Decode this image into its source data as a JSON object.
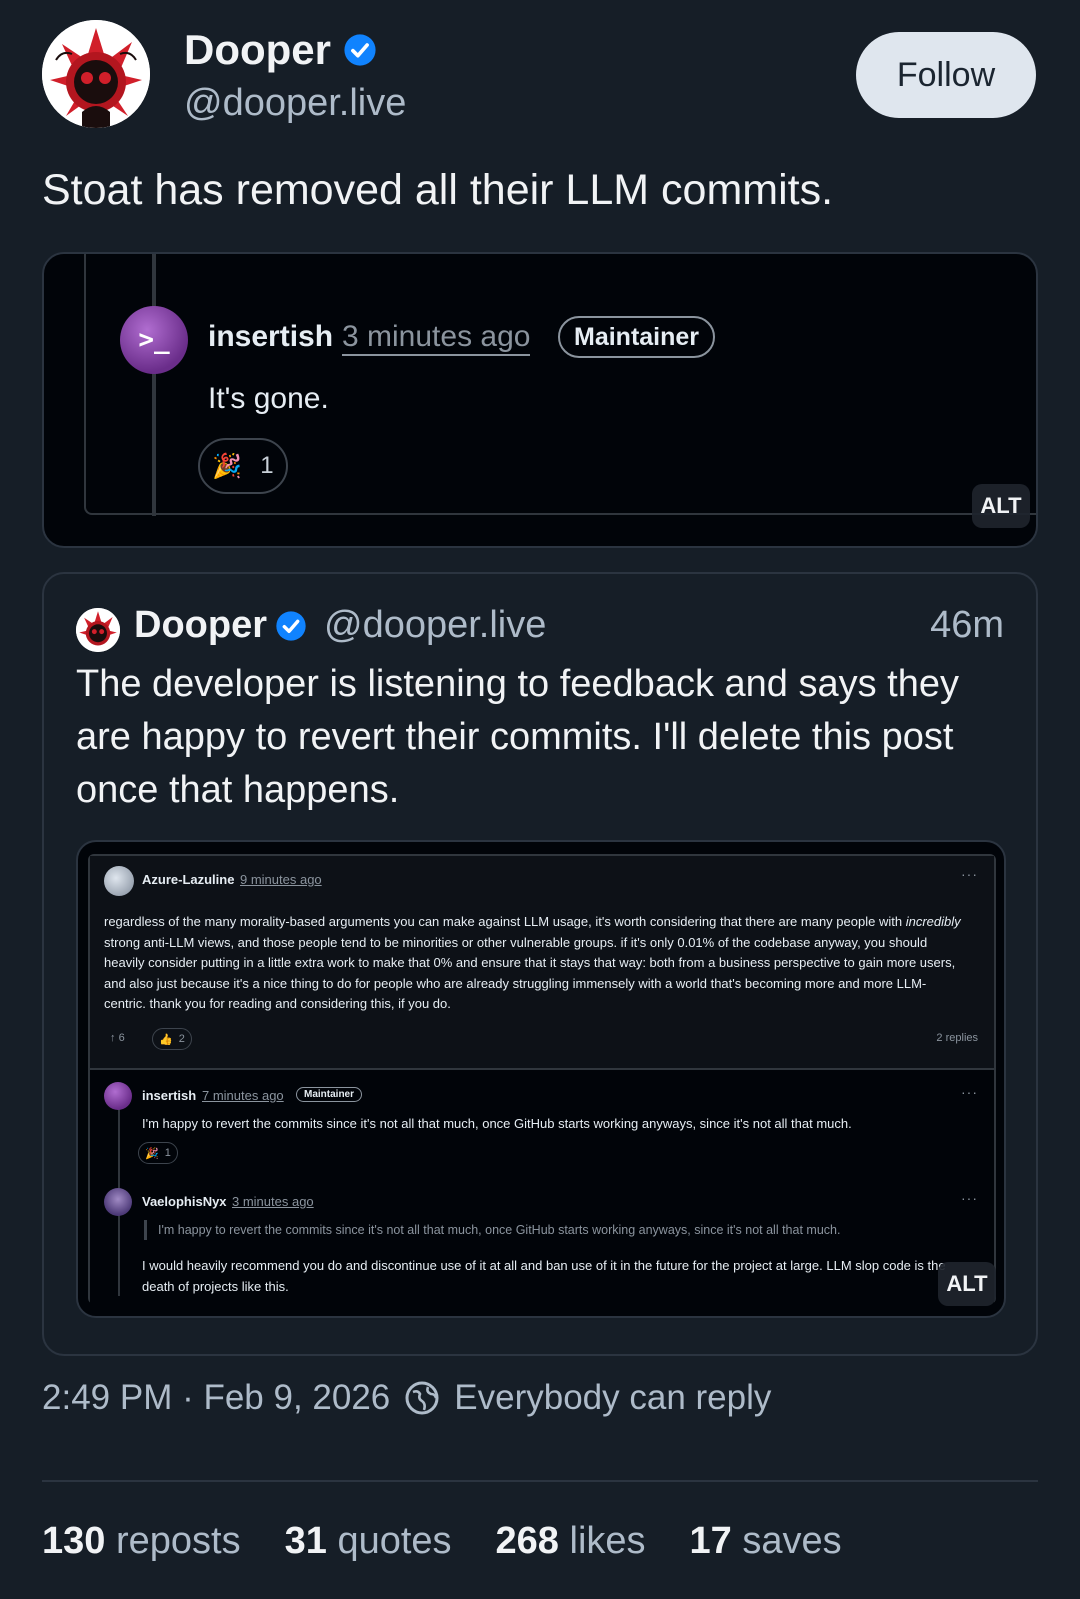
{
  "author": {
    "name": "Dooper",
    "handle": "@dooper.live",
    "avatar_icon": "spiky-red-creature-avatar",
    "verified": true
  },
  "follow_label": "Follow",
  "post_text": "Stoat has removed all their LLM commits.",
  "image1": {
    "user": "insertish",
    "time": "3 minutes ago",
    "badge": "Maintainer",
    "message": "It's gone.",
    "reaction_count": "1",
    "reaction_icon": "party-popper-icon",
    "alt_label": "ALT"
  },
  "quote": {
    "name": "Dooper",
    "handle": "@dooper.live",
    "time": "46m",
    "text": "The developer is listening to feedback and says they are happy to revert their commits. I'll delete this post once that happens.",
    "image": {
      "alt_label": "ALT",
      "comment1": {
        "user": "Azure-Lazuline",
        "time": "9 minutes ago",
        "menu": "···",
        "body_lead": "regardless of the many morality-based arguments you can make against LLM usage, it's worth considering that there are many people with",
        "body_em": "incredibly",
        "body_rest": "strong anti-LLM views, and those people tend to be minorities or other vulnerable groups. if it's only 0.01% of the codebase anyway, you should heavily consider putting in a little extra work to make that 0% and ensure that it stays that way: both from a business perspective to gain more users, and also just because it's a nice thing to do for people who are already struggling immensely with a world that's becoming more and more LLM-centric. thank you for reading and considering this, if you do.",
        "upvotes": "6",
        "thumbs": "2",
        "replies": "2 replies"
      },
      "comment2": {
        "user": "insertish",
        "time": "7 minutes ago",
        "badge": "Maintainer",
        "menu": "···",
        "body": "I'm happy to revert the commits since it's not all that much, once GitHub starts working anyways, since it's not all that much.",
        "reaction_count": "1"
      },
      "comment3": {
        "user": "VaelophisNyx",
        "time": "3 minutes ago",
        "menu": "···",
        "quoted": "I'm happy to revert the commits since it's not all that much, once GitHub starts working anyways, since it's not all that much.",
        "body": "I would heavily recommend you do and discontinue use of it at all and ban use of it in the future for the project at large. LLM slop code is the death of projects like this."
      }
    }
  },
  "meta": {
    "timestamp": "2:49 PM · Feb 9, 2026",
    "reply_setting": "Everybody can reply"
  },
  "stats": {
    "reposts_count": "130",
    "reposts_label": "reposts",
    "quotes_count": "31",
    "quotes_label": "quotes",
    "likes_count": "268",
    "likes_label": "likes",
    "saves_count": "17",
    "saves_label": "saves"
  },
  "colors": {
    "background": "#161e27",
    "verified": "#1083fe",
    "muted": "#aebbc9"
  }
}
